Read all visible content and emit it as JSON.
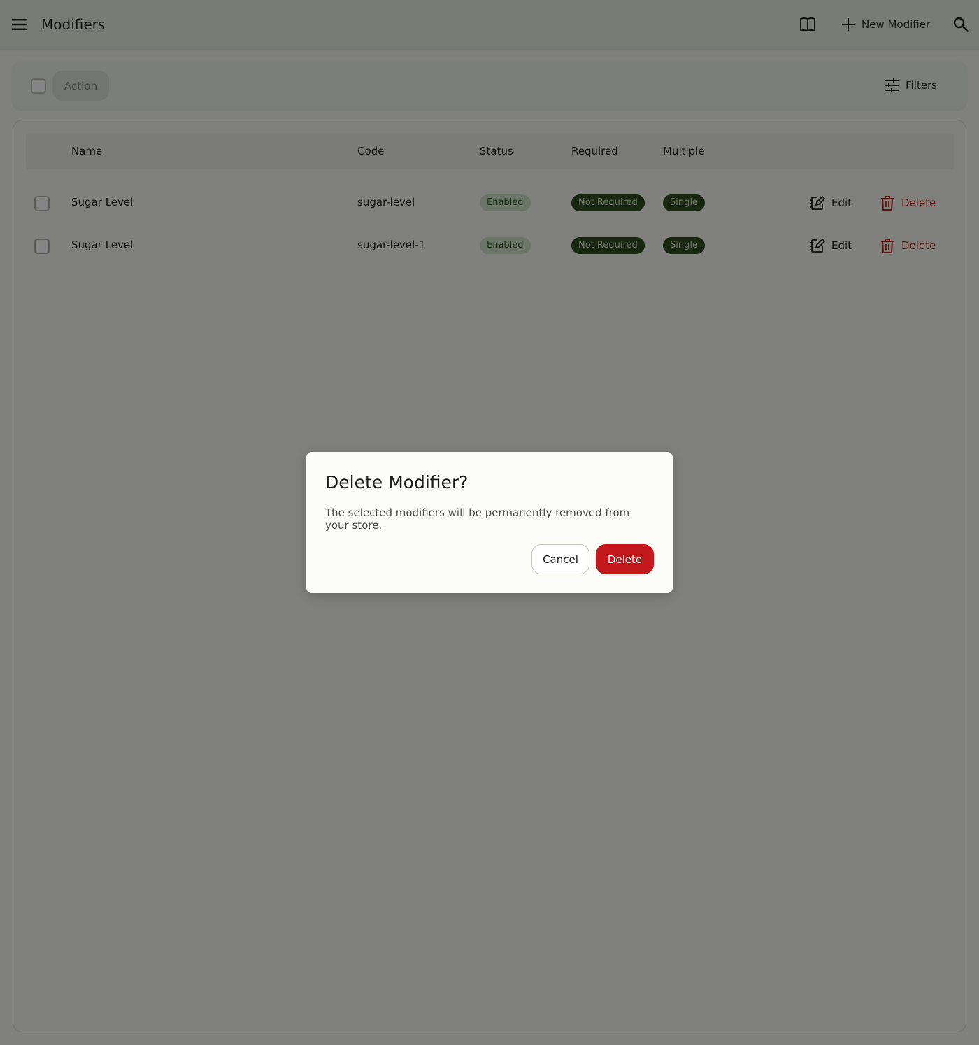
{
  "appbar": {
    "title": "Modifiers",
    "new_label": "New Modifier",
    "icons": [
      "menu-icon",
      "book-icon",
      "plus-icon",
      "search-icon"
    ]
  },
  "toolbar": {
    "action_label": "Action",
    "filters_label": "Filters"
  },
  "table": {
    "columns": [
      "Name",
      "Code",
      "Status",
      "Required",
      "Multiple"
    ],
    "rows": [
      {
        "name": "Sugar Level",
        "code": "sugar-level",
        "status": "Enabled",
        "required": "Not Required",
        "multiple": "Single",
        "edit_label": "Edit",
        "delete_label": "Delete"
      },
      {
        "name": "Sugar Level",
        "code": "sugar-level-1",
        "status": "Enabled",
        "required": "Not Required",
        "multiple": "Single",
        "edit_label": "Edit",
        "delete_label": "Delete"
      }
    ]
  },
  "dialog": {
    "title": "Delete Modifier?",
    "body": "The selected modifiers will be permanently removed from your store.",
    "cancel_label": "Cancel",
    "delete_label": "Delete"
  },
  "colors": {
    "danger": "#c3191c",
    "badge_dark": "#2f4b1f",
    "badge_status": "#cfe3c7",
    "surface": "#f5f6ef"
  }
}
